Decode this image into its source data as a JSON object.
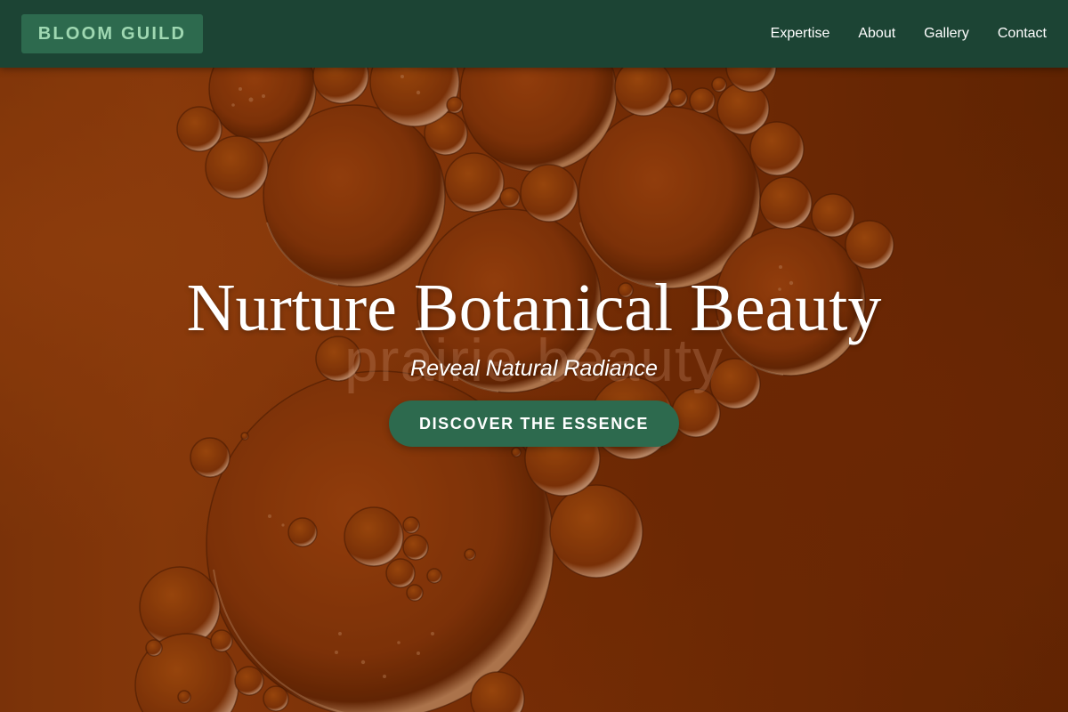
{
  "navbar": {
    "brand": "BLOOM GUILD",
    "links": [
      "Expertise",
      "About",
      "Gallery",
      "Contact"
    ]
  },
  "hero": {
    "title": "Nurture Botanical Beauty",
    "subtitle": "Reveal Natural Radiance",
    "cta_label": "DISCOVER THE ESSENCE",
    "background_watermark": "prairie beauty",
    "background_image": "amber-oil-bubbles"
  },
  "colors": {
    "navbar_bg": "#1c4434",
    "brand_bg": "#2d6a4e",
    "brand_text": "#9fd8b2",
    "cta_bg": "#2d6a4e",
    "hero_base": "#8a3608",
    "text_light": "#ffffff"
  }
}
